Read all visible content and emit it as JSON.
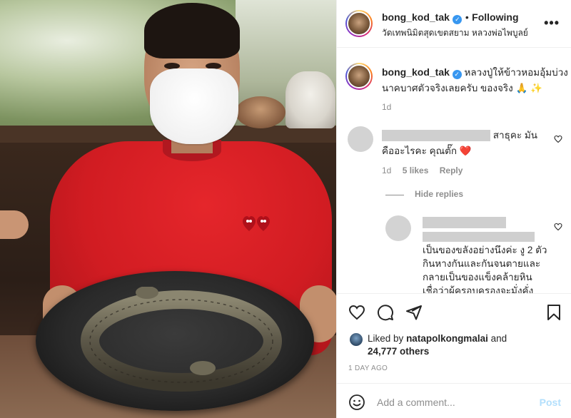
{
  "post": {
    "username": "bong_kod_tak",
    "verified_mark": "✓",
    "separator": "•",
    "follow_state": "Following",
    "location": "วัดเทพนิมิตสุดเขตสยาม หลวงพ่อไพบูลย์",
    "more_icon": "•••"
  },
  "caption": {
    "username": "bong_kod_tak",
    "line1": "หลวงปู่ให้ข้าวหอมอุ้มบ่วง",
    "line2": "นาคบาศตัวจริงเลยครับ ของจริง 🙏 ✨",
    "age": "1d"
  },
  "comment1": {
    "text_tail": "สาธุคะ มัน",
    "line2": "คืออะไรคะ คุณตั๊ก ❤️",
    "age": "1d",
    "likes": "5 likes",
    "reply": "Reply",
    "hide_replies": "Hide replies"
  },
  "reply1": {
    "line1": "เป็นของขลังอย่างนึงค่ะ งู 2 ตัว",
    "line2": "กินหางกันและกันจนตายและ",
    "line3": "กลายเป็นของแข็งคล้ายหิน",
    "line4": "เชื่อว่าผู้ครอบครองจะมั่งคั่ง"
  },
  "likes": {
    "prefix": "Liked by",
    "user": "natapolkongmalai",
    "and": "and",
    "count": "24,777 others"
  },
  "time_ago": "1 DAY AGO",
  "add_comment": {
    "placeholder": "Add a comment...",
    "post_label": "Post"
  },
  "colors": {
    "verified": "#3897f0",
    "post_button_disabled": "#b2dffc",
    "heart": "#ed4956"
  }
}
